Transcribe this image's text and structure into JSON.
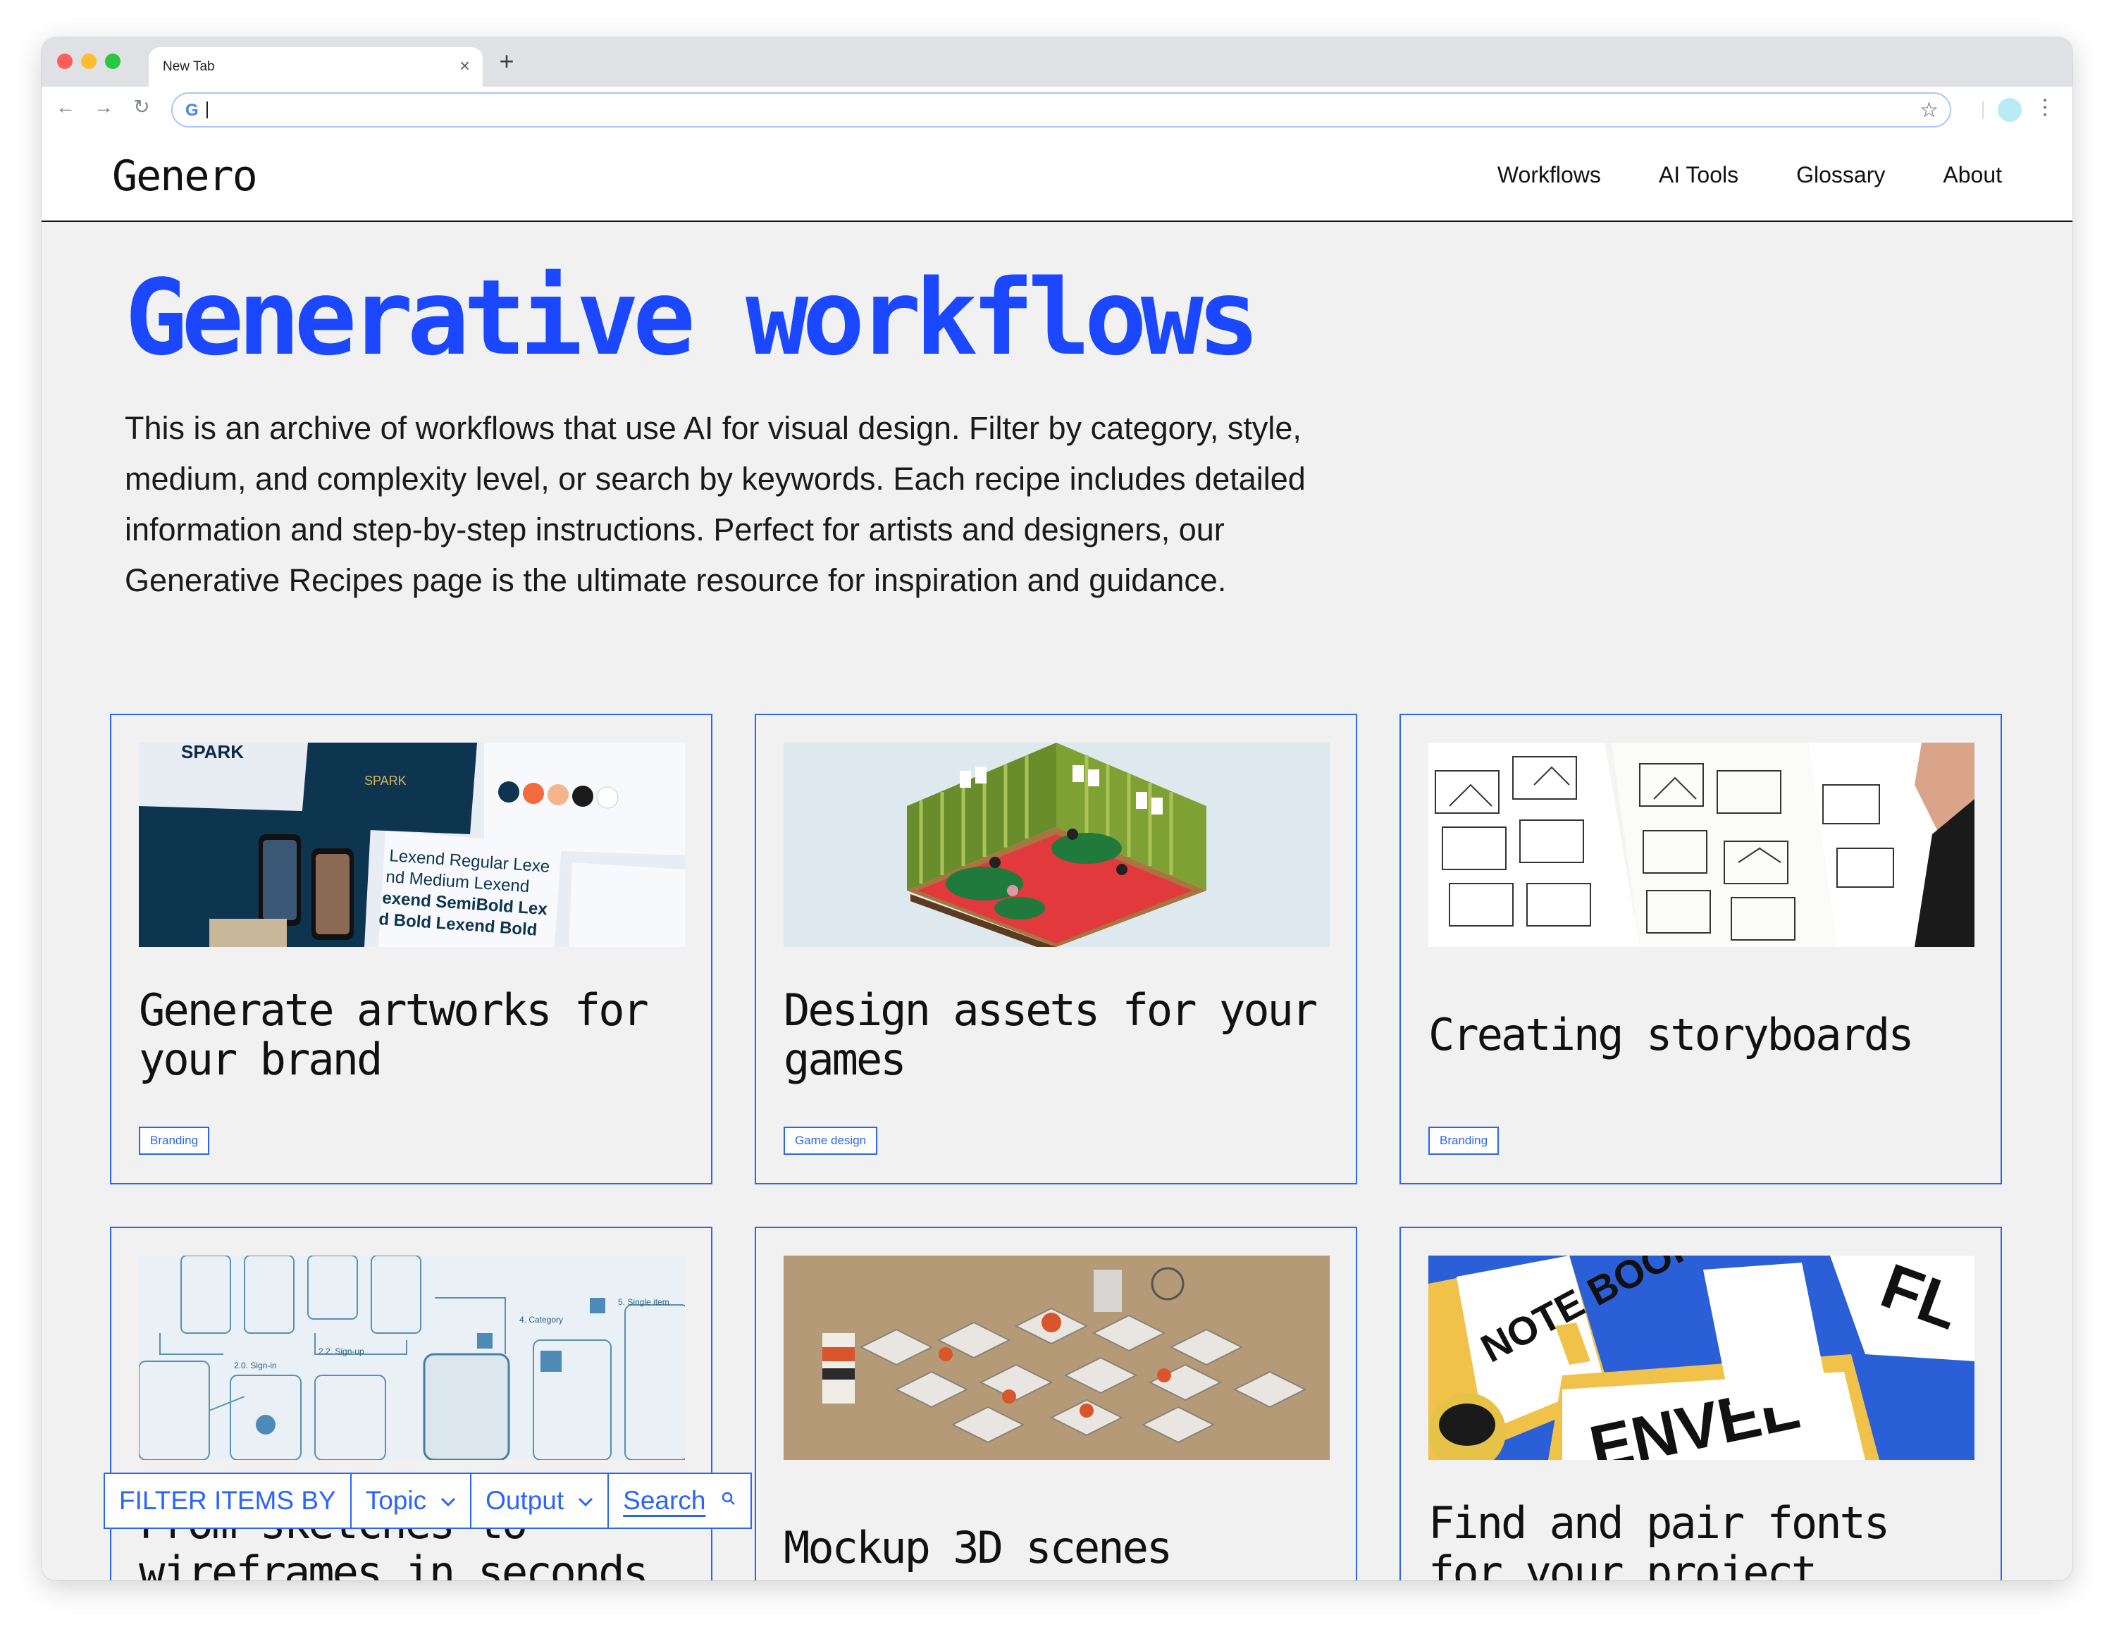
{
  "browser": {
    "tab_title": "New Tab",
    "tab_close": "×",
    "new_tab": "+",
    "back": "←",
    "forward": "→",
    "reload": "↻",
    "omnibox_icon": "G",
    "bookmark": "☆",
    "menu": "⋮"
  },
  "site": {
    "logo": "Genero",
    "nav": [
      "Workflows",
      "AI Tools",
      "Glossary",
      "About"
    ]
  },
  "hero": {
    "title": "Generative workflows",
    "intro_lines": [
      "This is an archive of workflows that use AI for visual design. Filter by category, style,",
      "medium, and complexity level, or search by keywords. Each recipe includes detailed",
      "information and step-by-step instructions. Perfect for artists and designers, our",
      "Generative Recipes page is the ultimate resource for inspiration and guidance."
    ]
  },
  "cards": [
    {
      "title": "Generate artworks for your brand",
      "tag": "Branding"
    },
    {
      "title": "Design assets for your games",
      "tag": "Game design"
    },
    {
      "title": "Creating storyboards",
      "tag": "Branding"
    },
    {
      "title": "From sketches to wireframes in seconds"
    },
    {
      "title": "Mockup 3D scenes"
    },
    {
      "title": "Find and pair fonts for your project"
    }
  ],
  "thumb_text": {
    "spark": "SPARK",
    "fonts": [
      "Lexend Regular Lexe",
      "nd Medium Lexend",
      "exend SemiBold Lex",
      "d Bold Lexend Bold"
    ],
    "flow_labels": [
      "2.0. Sign-in",
      "2.2. Sign-up",
      "4. Category",
      "5. Single item"
    ],
    "notebook": "NOTE BOOK",
    "envelope": "ENVEL"
  },
  "filter": {
    "label": "FILTER ITEMS BY",
    "topic": "Topic",
    "output": "Output",
    "search": "Search",
    "chevron": "⌄",
    "search_icon": "🔍"
  },
  "colors": {
    "accent": "#2a64ff",
    "title_blue": "#1a47ff",
    "page_bg": "#f1f1f1"
  }
}
